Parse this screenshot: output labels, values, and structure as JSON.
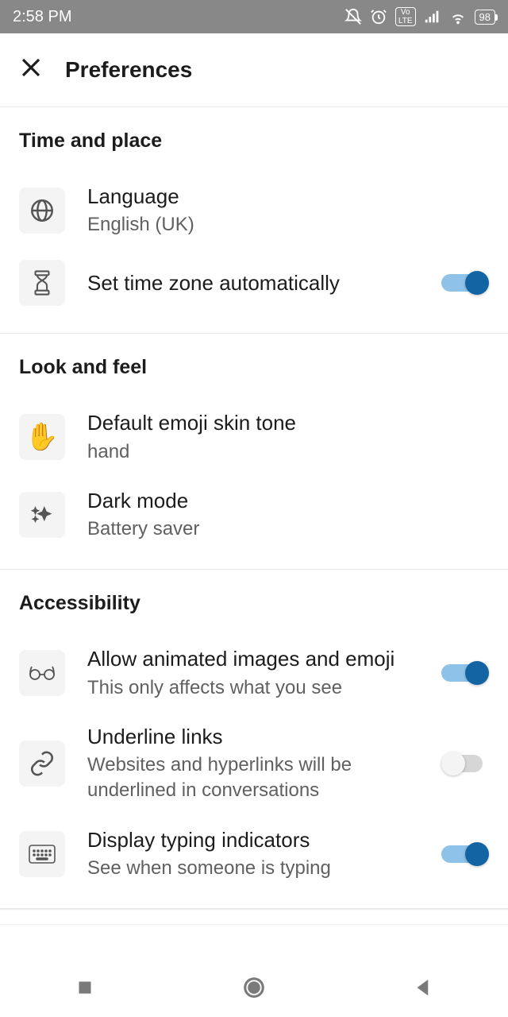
{
  "status": {
    "time": "2:58 PM",
    "battery": "98"
  },
  "header": {
    "title": "Preferences"
  },
  "sections": {
    "time_place": {
      "title": "Time and place",
      "language": {
        "title": "Language",
        "value": "English (UK)"
      },
      "timezone": {
        "title": "Set time zone automatically",
        "on": true
      }
    },
    "look_feel": {
      "title": "Look and feel",
      "emoji_tone": {
        "title": "Default emoji skin tone",
        "value": "hand"
      },
      "dark_mode": {
        "title": "Dark mode",
        "value": "Battery saver"
      }
    },
    "accessibility": {
      "title": "Accessibility",
      "animated": {
        "title": "Allow animated images and emoji",
        "sub": "This only affects what you see",
        "on": true
      },
      "underline": {
        "title": "Underline links",
        "sub": "Websites and hyperlinks will be underlined in conversations",
        "on": false
      },
      "typing": {
        "title": "Display typing indicators",
        "sub": "See when someone is typing",
        "on": true
      }
    }
  }
}
